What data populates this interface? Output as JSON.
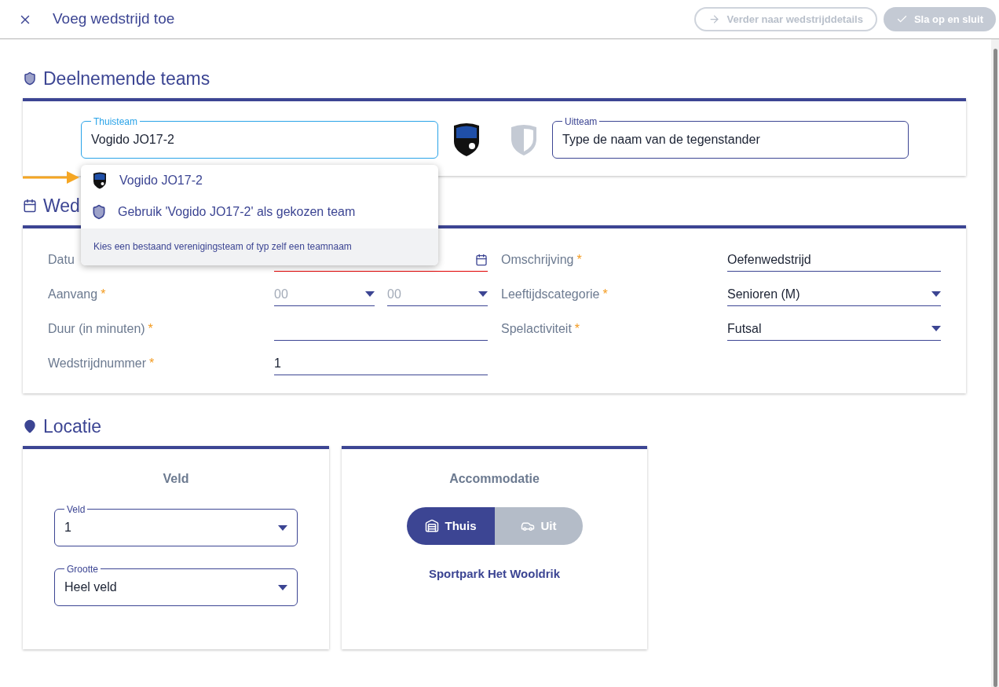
{
  "header": {
    "title": "Voeg wedstrijd toe",
    "buttons": [
      {
        "label": "Verder naar wedstrijddetails",
        "kind": "outline",
        "disabled": true
      },
      {
        "label": "Sla op en sluit",
        "kind": "solid",
        "disabled": true
      }
    ]
  },
  "teams": {
    "heading": "Deelnemende teams",
    "home": {
      "label": "Thuisteam",
      "value": "Vogido JO17-2",
      "focused": true
    },
    "away": {
      "label": "Uitteam",
      "placeholder": "Type de naam van de tegenstander"
    },
    "suggestions": {
      "items": [
        {
          "label": "Vogido JO17-2",
          "kind": "club"
        },
        {
          "label": "Gebruik 'Vogido JO17-2' als gekozen team",
          "kind": "custom"
        }
      ],
      "hint": "Kies een bestaand verenigingsteam of typ zelf een teamnaam"
    }
  },
  "match": {
    "heading": "Wed",
    "fields": [
      {
        "label": "Datu",
        "kind": "date",
        "invalid": true
      },
      {
        "label": "Omschrijving",
        "required_mark": "*",
        "kind": "text",
        "value": "Oefenwedstrijd"
      },
      {
        "label": "Aanvang",
        "required_mark": "*",
        "kind": "time",
        "parts": [
          "00",
          "00"
        ]
      },
      {
        "label": "Leeftijdscategorie",
        "required_mark": "*",
        "kind": "select",
        "value": "Senioren (M)"
      },
      {
        "label": "Duur (in minuten)",
        "required_mark": "*",
        "kind": "text"
      },
      {
        "label": "Spelactiviteit",
        "required_mark": "*",
        "kind": "select",
        "value": "Futsal"
      },
      {
        "label": "Wedstrijdnummer",
        "required_mark": "*",
        "kind": "text",
        "value": "1"
      }
    ]
  },
  "location": {
    "heading": "Locatie",
    "field_card": {
      "title": "Veld",
      "selects": [
        {
          "label": "Veld",
          "value": "1"
        },
        {
          "label": "Grootte",
          "value": "Heel veld"
        }
      ]
    },
    "accommodation": {
      "title": "Accommodatie",
      "options": [
        {
          "label": "Thuis",
          "kind": "home",
          "selected": true
        },
        {
          "label": "Uit",
          "kind": "away",
          "selected": false
        }
      ],
      "venue": "Sportpark Het Wooldrik"
    }
  }
}
